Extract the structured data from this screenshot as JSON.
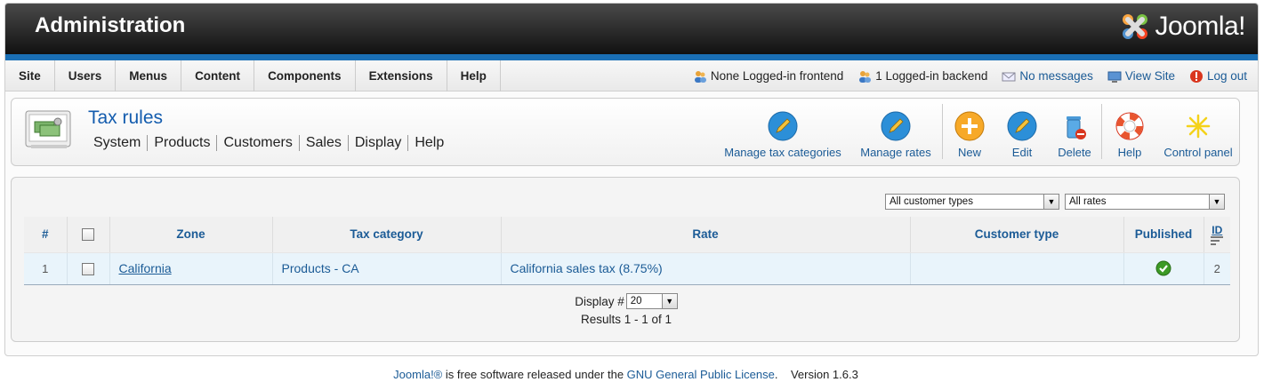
{
  "header": {
    "title": "Administration",
    "logo_text": "Joomla!"
  },
  "menu": [
    "Site",
    "Users",
    "Menus",
    "Content",
    "Components",
    "Extensions",
    "Help"
  ],
  "status": {
    "frontend": "None Logged-in frontend",
    "backend": "1 Logged-in backend",
    "messages": "No messages",
    "view_site": "View Site",
    "logout": "Log out"
  },
  "page": {
    "title": "Tax rules",
    "submenu": [
      "System",
      "Products",
      "Customers",
      "Sales",
      "Display",
      "Help"
    ]
  },
  "toolbar": {
    "manage_tax_categories": "Manage tax categories",
    "manage_rates": "Manage rates",
    "new": "New",
    "edit": "Edit",
    "delete": "Delete",
    "help": "Help",
    "control_panel": "Control panel"
  },
  "filters": {
    "customer_types": "All customer types",
    "rates": "All rates"
  },
  "table": {
    "headers": {
      "num": "#",
      "zone": "Zone",
      "tax_category": "Tax category",
      "rate": "Rate",
      "customer_type": "Customer type",
      "published": "Published",
      "id": "ID"
    },
    "rows": [
      {
        "num": "1",
        "zone": "California",
        "tax_category": "Products - CA",
        "rate": "California sales tax (8.75%)",
        "customer_type": "",
        "published": true,
        "id": "2"
      }
    ]
  },
  "pager": {
    "display_label": "Display #",
    "display_value": "20",
    "results": "Results 1 - 1 of 1"
  },
  "footer": {
    "joomla": "Joomla!®",
    "middle": " is free software released under the ",
    "license": "GNU General Public License",
    "end": ".",
    "version": "Version 1.6.3"
  },
  "colors": {
    "accent": "#1a6fb5",
    "link": "#1b5b96",
    "title": "#135cae"
  }
}
